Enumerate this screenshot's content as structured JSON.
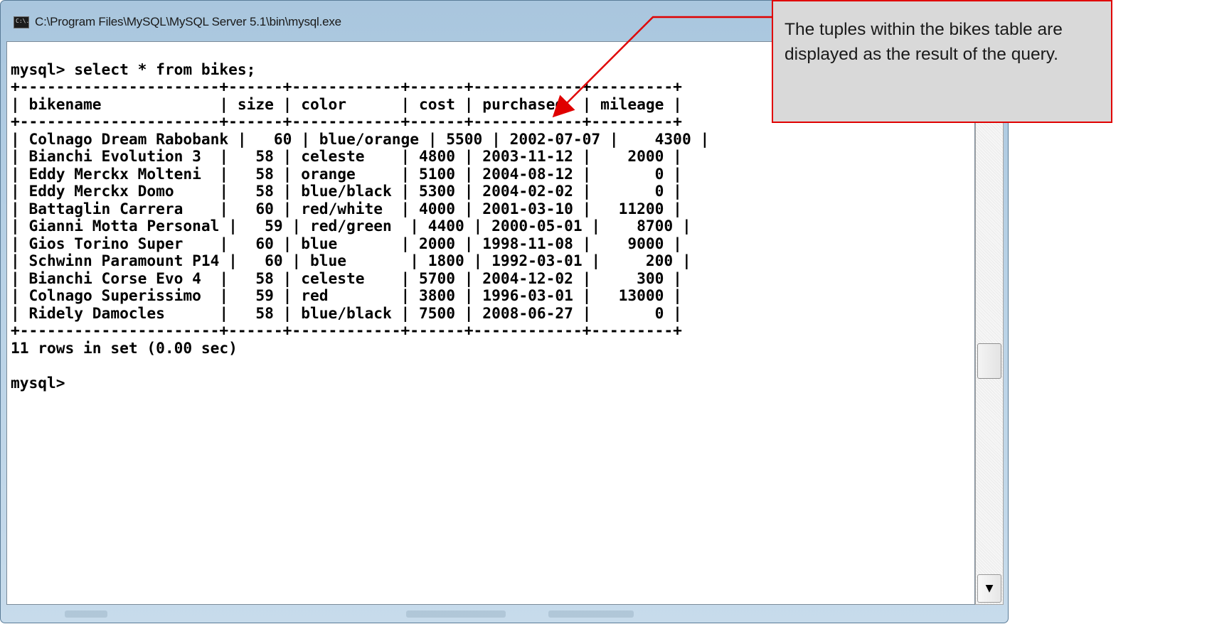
{
  "window": {
    "title": "C:\\Program Files\\MySQL\\MySQL Server 5.1\\bin\\mysql.exe"
  },
  "console": {
    "lines": [
      "",
      "mysql> select * from bikes;",
      "+----------------------+------+------------+------+------------+---------+",
      "| bikename             | size | color      | cost | purchased  | mileage |",
      "+----------------------+------+------------+------+------------+---------+",
      "| Colnago Dream Rabobank |   60 | blue/orange | 5500 | 2002-07-07 |    4300 |",
      "| Bianchi Evolution 3  |   58 | celeste    | 4800 | 2003-11-12 |    2000 |",
      "| Eddy Merckx Molteni  |   58 | orange     | 5100 | 2004-08-12 |       0 |",
      "| Eddy Merckx Domo     |   58 | blue/black | 5300 | 2004-02-02 |       0 |",
      "| Battaglin Carrera    |   60 | red/white  | 4000 | 2001-03-10 |   11200 |",
      "| Gianni Motta Personal |   59 | red/green  | 4400 | 2000-05-01 |    8700 |",
      "| Gios Torino Super    |   60 | blue       | 2000 | 1998-11-08 |    9000 |",
      "| Schwinn Paramount P14 |   60 | blue       | 1800 | 1992-03-01 |     200 |",
      "| Bianchi Corse Evo 4  |   58 | celeste    | 5700 | 2004-12-02 |     300 |",
      "| Colnago Superissimo  |   59 | red        | 3800 | 1996-03-01 |   13000 |",
      "| Ridely Damocles      |   58 | blue/black | 7500 | 2008-06-27 |       0 |",
      "+----------------------+------+------------+------+------------+---------+",
      "11 rows in set (0.00 sec)",
      "",
      "mysql>"
    ]
  },
  "table": {
    "columns": [
      "bikename",
      "size",
      "color",
      "cost",
      "purchased",
      "mileage"
    ],
    "rows": [
      [
        "Colnago Dream Rabobank",
        "60",
        "blue/orange",
        "5500",
        "2002-07-07",
        "4300"
      ],
      [
        "Bianchi Evolution 3",
        "58",
        "celeste",
        "4800",
        "2003-11-12",
        "2000"
      ],
      [
        "Eddy Merckx Molteni",
        "58",
        "orange",
        "5100",
        "2004-08-12",
        "0"
      ],
      [
        "Eddy Merckx Domo",
        "58",
        "blue/black",
        "5300",
        "2004-02-02",
        "0"
      ],
      [
        "Battaglin Carrera",
        "60",
        "red/white",
        "4000",
        "2001-03-10",
        "11200"
      ],
      [
        "Gianni Motta Personal",
        "59",
        "red/green",
        "4400",
        "2000-05-01",
        "8700"
      ],
      [
        "Gios Torino Super",
        "60",
        "blue",
        "2000",
        "1998-11-08",
        "9000"
      ],
      [
        "Schwinn Paramount P14",
        "60",
        "blue",
        "1800",
        "1992-03-01",
        "200"
      ],
      [
        "Bianchi Corse Evo 4",
        "58",
        "celeste",
        "5700",
        "2004-12-02",
        "300"
      ],
      [
        "Colnago Superissimo",
        "59",
        "red",
        "3800",
        "1996-03-01",
        "13000"
      ],
      [
        "Ridely Damocles",
        "58",
        "blue/black",
        "7500",
        "2008-06-27",
        "0"
      ]
    ]
  },
  "callout": {
    "text": "The tuples within the bikes table are displayed as the result of the query.",
    "border_color": "#e00000",
    "background": "#d9d9d9"
  },
  "icons": {
    "app": "console-app-icon",
    "scroll_down": "scroll-down-arrow-icon"
  }
}
